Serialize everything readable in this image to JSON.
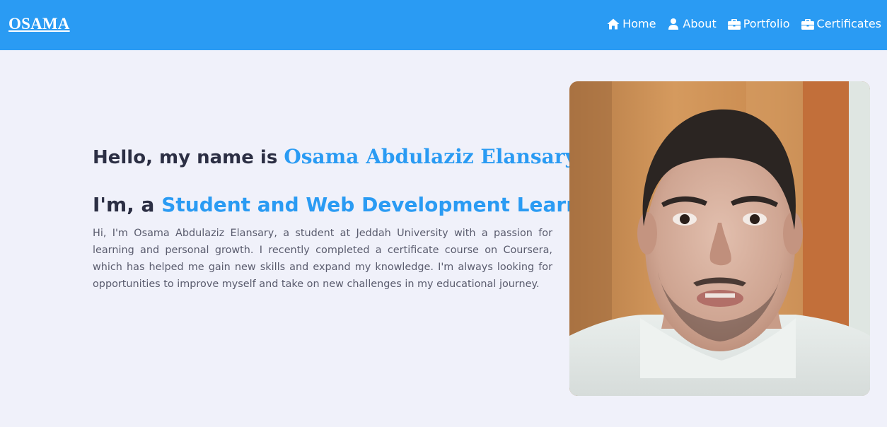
{
  "header": {
    "logo": "OSAMA",
    "nav": [
      {
        "label": "Home",
        "icon": "home-icon"
      },
      {
        "label": "About",
        "icon": "user-icon"
      },
      {
        "label": "Portfolio",
        "icon": "briefcase-icon"
      },
      {
        "label": "Certificates",
        "icon": "briefcase-icon"
      }
    ]
  },
  "hero": {
    "greeting_prefix": "Hello, my name is ",
    "name": "Osama Abdulaziz Elansary",
    "role_prefix": "I'm, a ",
    "role": "Student and Web Development Learner",
    "bio": "Hi, I'm Osama Abdulaziz Elansary, a student at Jeddah University with a passion for learning and personal growth. I recently completed a certificate course on Coursera, which has helped me gain new skills and expand my knowledge. I'm always looking for opportunities to improve myself and take on new challenges in my educational journey."
  },
  "colors": {
    "accent": "#2a9bf3",
    "background": "#f0f1fa",
    "heading": "#2c2f44",
    "body_text": "#5a5c6e"
  }
}
